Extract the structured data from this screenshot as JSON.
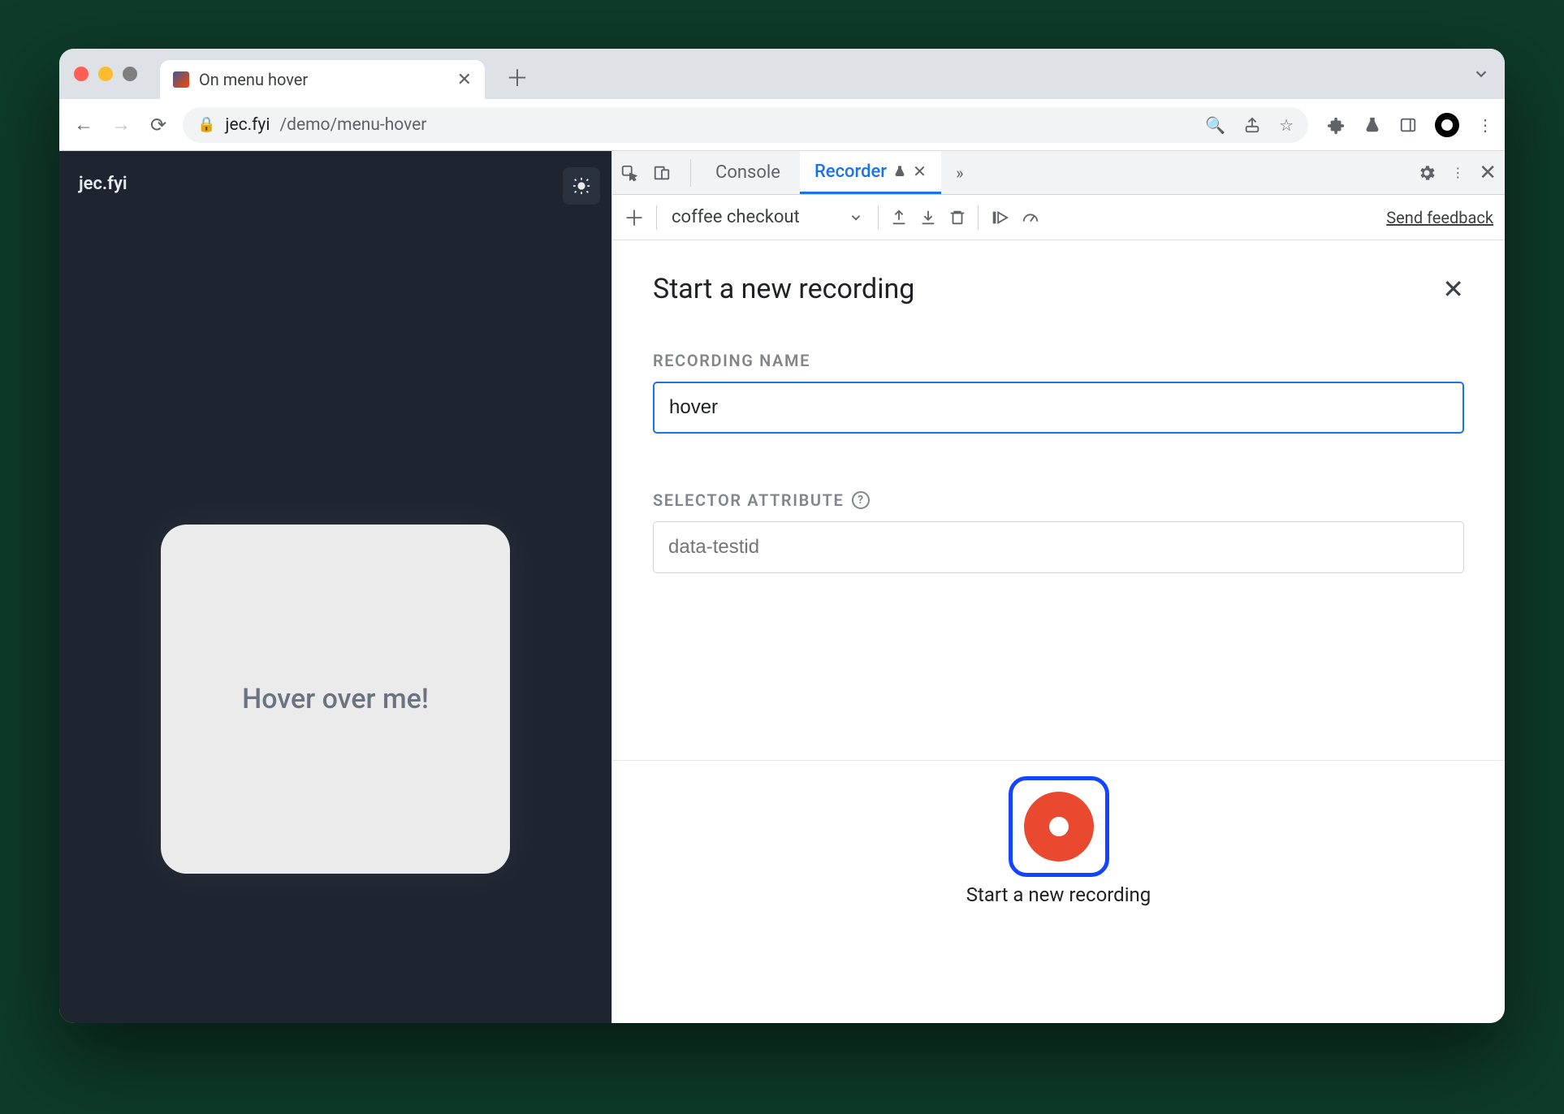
{
  "browser": {
    "tab_title": "On menu hover",
    "url_host": "jec.fyi",
    "url_path": "/demo/menu-hover"
  },
  "page": {
    "site_name": "jec.fyi",
    "card_text": "Hover over me!"
  },
  "devtools": {
    "tabs": {
      "console": "Console",
      "recorder": "Recorder"
    },
    "toolbar": {
      "recording_select": "coffee checkout",
      "feedback": "Send feedback"
    },
    "panel": {
      "title": "Start a new recording",
      "name_label": "RECORDING NAME",
      "name_value": "hover",
      "selector_label": "SELECTOR ATTRIBUTE",
      "selector_placeholder": "data-testid",
      "record_button_label": "Start a new recording"
    }
  }
}
